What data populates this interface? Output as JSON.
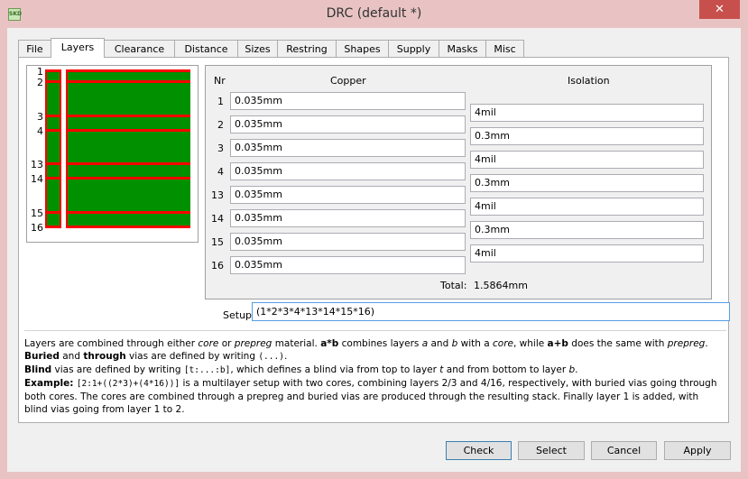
{
  "window": {
    "title": "DRC (default *)",
    "close": "✕",
    "app_icon": "SKD"
  },
  "tabs": [
    "File",
    "Layers",
    "Clearance",
    "Distance",
    "Sizes",
    "Restring",
    "Shapes",
    "Supply",
    "Masks",
    "Misc"
  ],
  "active_tab": "Layers",
  "stack_preview": {
    "labels": [
      "1",
      "2",
      "3",
      "4",
      "13",
      "14",
      "15",
      "16"
    ],
    "colors": {
      "copper": "#ff0000",
      "core": "#009000"
    }
  },
  "layers": {
    "header_nr": "Nr",
    "header_copper": "Copper",
    "header_isolation": "Isolation",
    "rows": [
      {
        "nr": "1",
        "copper": "0.035mm"
      },
      {
        "nr": "2",
        "copper": "0.035mm"
      },
      {
        "nr": "3",
        "copper": "0.035mm"
      },
      {
        "nr": "4",
        "copper": "0.035mm"
      },
      {
        "nr": "13",
        "copper": "0.035mm"
      },
      {
        "nr": "14",
        "copper": "0.035mm"
      },
      {
        "nr": "15",
        "copper": "0.035mm"
      },
      {
        "nr": "16",
        "copper": "0.035mm"
      }
    ],
    "isolation": [
      "4mil",
      "0.3mm",
      "4mil",
      "0.3mm",
      "4mil",
      "0.3mm",
      "4mil"
    ],
    "total_label": "Total:",
    "total_value": "1.5864mm"
  },
  "setup": {
    "label": "Setup",
    "value": "(1*2*3*4*13*14*15*16)"
  },
  "help": {
    "p1": [
      {
        "t": "Layers are combined through either "
      },
      {
        "t": "core",
        "i": true
      },
      {
        "t": " or "
      },
      {
        "t": "prepreg",
        "i": true
      },
      {
        "t": " material. "
      },
      {
        "t": "a*b",
        "b": true
      },
      {
        "t": " combines layers "
      },
      {
        "t": "a",
        "i": true
      },
      {
        "t": " and "
      },
      {
        "t": "b",
        "i": true
      },
      {
        "t": " with a "
      },
      {
        "t": "core",
        "i": true
      },
      {
        "t": ", while "
      },
      {
        "t": "a+b",
        "b": true
      },
      {
        "t": " does the same with "
      },
      {
        "t": "prepreg",
        "i": true
      },
      {
        "t": "."
      }
    ],
    "p2": [
      {
        "t": "Buried",
        "b": true
      },
      {
        "t": " and "
      },
      {
        "t": "through",
        "b": true
      },
      {
        "t": " vias are defined by writing "
      },
      {
        "t": "(...)",
        "m": true
      },
      {
        "t": "."
      }
    ],
    "p3": [
      {
        "t": "Blind",
        "b": true
      },
      {
        "t": " vias are defined by writing "
      },
      {
        "t": "[t:...:b]",
        "m": true
      },
      {
        "t": ", which defines a blind via from top to layer "
      },
      {
        "t": "t",
        "i": true
      },
      {
        "t": " and from bottom to layer "
      },
      {
        "t": "b",
        "i": true
      },
      {
        "t": "."
      }
    ],
    "p4": [
      {
        "t": "Example:",
        "b": true
      },
      {
        "t": " "
      },
      {
        "t": "[2:1+((2*3)+(4*16))]",
        "m": true
      },
      {
        "t": " is a multilayer setup with two cores, combining layers 2/3 and 4/16, respectively, with buried vias going through both cores. The cores are combined through a prepreg and buried vias are produced through the resulting stack. Finally layer 1 is added, with blind vias going from layer 1 to 2."
      }
    ]
  },
  "buttons": {
    "check": "Check",
    "select": "Select",
    "cancel": "Cancel",
    "apply": "Apply"
  }
}
